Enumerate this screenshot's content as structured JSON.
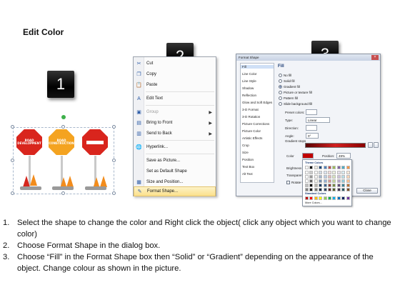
{
  "title": "Edit Color",
  "step_numbers": [
    "1",
    "2",
    "3"
  ],
  "signs": [
    {
      "text": "ROAD DEVELOPMENT",
      "color": "#d9251d"
    },
    {
      "text": "ROAD CONSTRUCTION",
      "color": "#f4a320"
    },
    {
      "text": "",
      "color": "#d9251d"
    }
  ],
  "context_menu": {
    "items": [
      {
        "icon": "scissors-icon",
        "glyph": "✂",
        "label": "Cut",
        "disabled": false,
        "submenu": false
      },
      {
        "icon": "copy-icon",
        "glyph": "❐",
        "label": "Copy",
        "disabled": false,
        "submenu": false
      },
      {
        "icon": "paste-icon",
        "glyph": "📋",
        "label": "Paste",
        "disabled": false,
        "submenu": false
      },
      {
        "icon": "edit-text-icon",
        "glyph": "A",
        "label": "Edit Text",
        "disabled": false,
        "submenu": false
      },
      {
        "icon": "group-icon",
        "glyph": "▣",
        "label": "Group",
        "disabled": true,
        "submenu": true
      },
      {
        "icon": "bring-front-icon",
        "glyph": "▤",
        "label": "Bring to Front",
        "disabled": false,
        "submenu": true
      },
      {
        "icon": "send-back-icon",
        "glyph": "▥",
        "label": "Send to Back",
        "disabled": false,
        "submenu": true
      },
      {
        "icon": "hyperlink-icon",
        "glyph": "🌐",
        "label": "Hyperlink...",
        "disabled": false,
        "submenu": false
      },
      {
        "icon": "save-picture-icon",
        "glyph": "",
        "label": "Save as Picture...",
        "disabled": false,
        "submenu": false
      },
      {
        "icon": "default-shape-icon",
        "glyph": "",
        "label": "Set as Default Shape",
        "disabled": false,
        "submenu": false
      },
      {
        "icon": "size-position-icon",
        "glyph": "▦",
        "label": "Size and Position...",
        "disabled": false,
        "submenu": false
      },
      {
        "icon": "format-shape-icon",
        "glyph": "✎",
        "label": "Format Shape...",
        "disabled": false,
        "submenu": false
      }
    ]
  },
  "format_dialog": {
    "title": "Format Shape",
    "close": "×",
    "categories": [
      "Fill",
      "Line Color",
      "Line Style",
      "Shadow",
      "Reflection",
      "Glow and Soft Edges",
      "3-D Format",
      "3-D Rotation",
      "Picture Corrections",
      "Picture Color",
      "Artistic Effects",
      "Crop",
      "Size",
      "Position",
      "Text Box",
      "Alt Text"
    ],
    "heading": "Fill",
    "fill_options": [
      {
        "label": "No fill",
        "checked": false
      },
      {
        "label": "Solid fill",
        "checked": false
      },
      {
        "label": "Gradient fill",
        "checked": true
      },
      {
        "label": "Picture or texture fill",
        "checked": false
      },
      {
        "label": "Pattern fill",
        "checked": false
      },
      {
        "label": "Slide background fill",
        "checked": false
      }
    ],
    "preset_label": "Preset colors:",
    "type_label": "Type:",
    "type_value": "Linear",
    "direction_label": "Direction:",
    "angle_label": "Angle:",
    "angle_value": "0°",
    "stops_label": "Gradient stops",
    "color_label": "Color",
    "position_label": "Position:",
    "position_value": "49%",
    "brightness_label": "Brightness",
    "transparency_label": "Transparency",
    "rotate_label": "Rotate with shape",
    "theme_colors_label": "Theme Colors",
    "standard_colors_label": "Standard Colors",
    "more_colors_label": "More Colors...",
    "close_button": "Close",
    "standard_colors": [
      "#c00000",
      "#ff0000",
      "#ffc000",
      "#ffff00",
      "#92d050",
      "#00b050",
      "#00b0f0",
      "#0070c0",
      "#002060",
      "#7030a0"
    ]
  },
  "steps": [
    {
      "num": "1.",
      "text": "Select the shape to change the color and Right click the object( click any object which you want to change color)"
    },
    {
      "num": "2.",
      "text": "Choose Format Shape in the dialog box."
    },
    {
      "num": "3.",
      "text": "Choose “Fill” in the Format Shape box then “Solid” or “Gradient” depending on the appearance of the object. Change colour as shown in the picture."
    }
  ]
}
